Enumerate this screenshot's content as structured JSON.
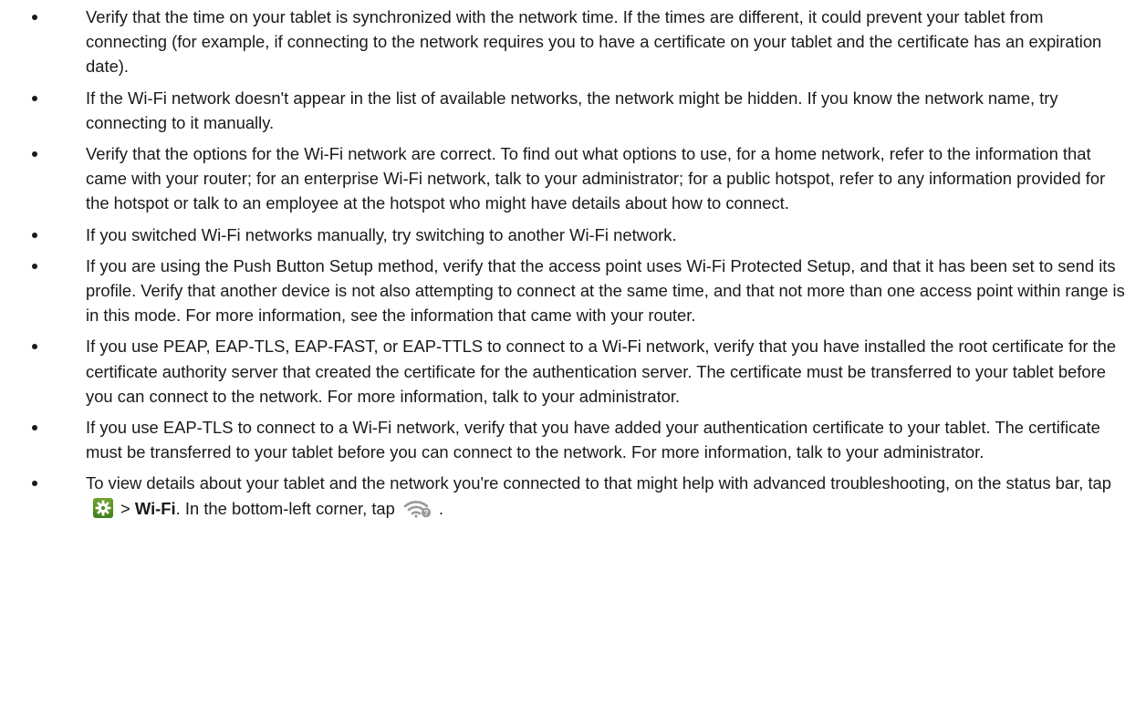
{
  "bullets": [
    "Verify that the time on your tablet is synchronized with the network time. If the times are different, it could prevent your tablet from connecting (for example, if connecting to the network requires you to have a certificate on your tablet and the certificate has an expiration date).",
    "If the Wi-Fi network doesn't appear in the list of available networks, the network might be hidden. If you know the network name, try connecting to it manually.",
    "Verify that the options for the Wi-Fi network are correct. To find out what options to use, for a home network, refer to the information that came with your router; for an enterprise Wi-Fi network, talk to your administrator; for a public hotspot, refer to any information provided for the hotspot or talk to an employee at the hotspot who might have details about how to connect.",
    "If you switched Wi-Fi networks manually, try switching to another Wi-Fi network.",
    "If you are using the Push Button Setup method, verify that the access point uses Wi-Fi Protected Setup, and that it has been set to send its profile. Verify that another device is not also attempting to connect at the same time, and that not more than one access point within range is in this mode. For more information, see the information that came with your router.",
    "If you use PEAP, EAP-TLS, EAP-FAST, or EAP-TTLS to connect to a Wi-Fi network, verify that you have installed the root certificate for the certificate authority server that created the certificate for the authentication server. The certificate must be transferred to your tablet before you can connect to the network. For more information, talk to your administrator.",
    "If you use EAP-TLS to connect to a Wi-Fi network, verify that you have added your authentication certificate to your tablet. The certificate must be transferred to your tablet before you can connect to the network. For more information, talk to your administrator."
  ],
  "last_bullet": {
    "text_before_icon": "To view details about your tablet and the network you're connected to that might help with advanced troubleshooting, on the status bar, tap",
    "gear_icon": "settings-gear-icon",
    "separator": ">",
    "bold_target": "Wi-Fi",
    "text_middle": ". In the bottom-left corner, tap",
    "wifi_icon": "wifi-question-icon",
    "text_end": "."
  },
  "colors": {
    "text": "#1a1a1a",
    "gear_icon_bg": "#4f8f24",
    "wifi_icon": "#9a9a9a"
  }
}
